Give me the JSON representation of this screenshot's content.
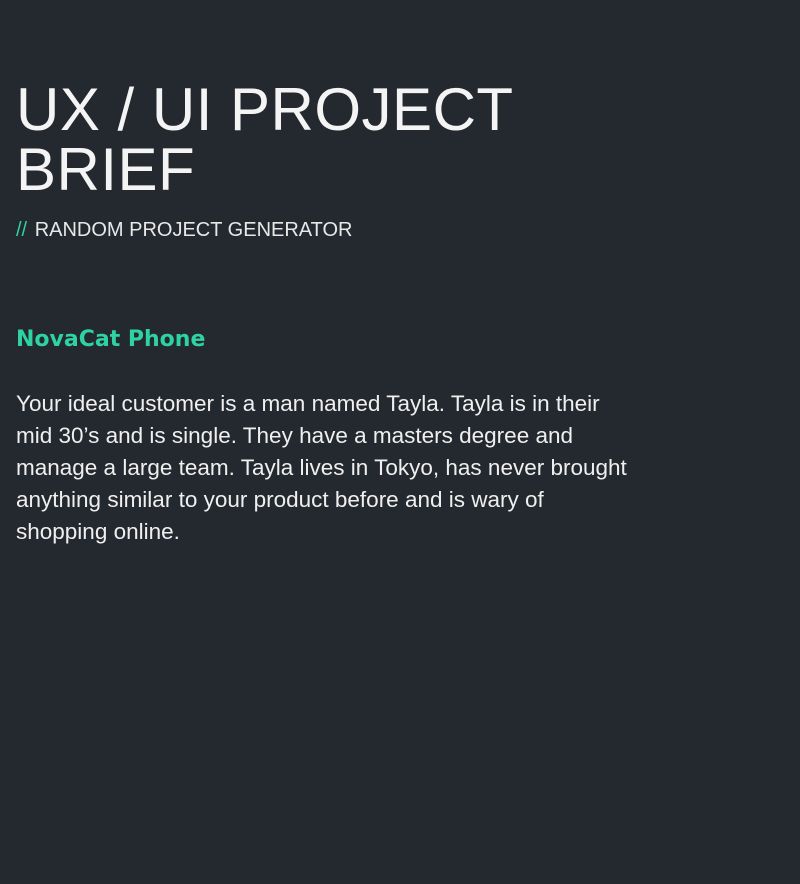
{
  "header": {
    "title": "UX / UI PROJECT\nBRIEF",
    "subtitle_prefix": "//",
    "subtitle": "RANDOM PROJECT GENERATOR"
  },
  "project": {
    "name": "NovaCat Phone",
    "brief": "Your ideal customer is a man named Tayla. Tayla is in their mid 30’s and is single. They have a masters degree and manage a large team. Tayla lives in Tokyo, has never brought anything similar to your product before and is wary of shopping online."
  },
  "colors": {
    "background": "#24292f",
    "accent": "#2ed3a4",
    "text": "#f4f4f4"
  }
}
